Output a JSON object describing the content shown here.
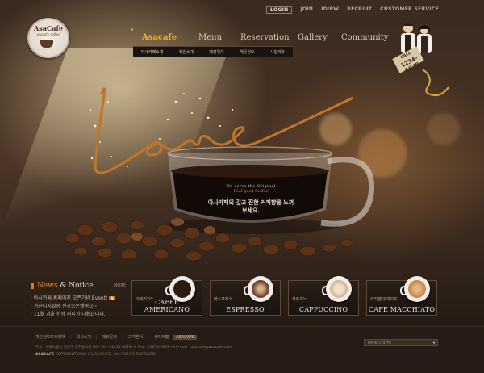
{
  "top_links": [
    "LOGIN",
    "JOIN",
    "ID/PW",
    "RECRUIT",
    "CUSTOMER SERVICE"
  ],
  "brand": {
    "logo_text": "AsaCafe",
    "logo_sub": "asacafe coffee"
  },
  "nav": [
    "Asacafe",
    "Menu",
    "Reservation",
    "Gallery",
    "Community"
  ],
  "subnav": [
    "아사카페소개",
    "직원소개",
    "매장위치",
    "채용정보",
    "사업제휴"
  ],
  "hero": {
    "script_word": "Love",
    "tagline_1": "We serve the Original",
    "tagline_2": "Feel-good Coffee",
    "tagline_kr": "아사카페의 깊고 진한 커피향을 느껴보세요.",
    "tag_label": "CALL",
    "tag_number": "1234-5678"
  },
  "news": {
    "title_prefix": "News",
    "title_rest": " & Notice",
    "more": "MORE",
    "items": [
      {
        "text": "아사카페 홈페이지 오픈기념 Event!",
        "badge": "N"
      },
      {
        "text": "가산디지털점 신규오픈했어요~",
        "badge": ""
      },
      {
        "text": "11월 겨울 한정 커피가 나왔습니다.",
        "badge": ""
      }
    ]
  },
  "menu_cards": [
    {
      "kr": "아메리카노",
      "en": "CAFFE AMERICANO",
      "coffee": "#2a1a10"
    },
    {
      "kr": "에스프레소",
      "en": "ESPRESSO",
      "coffee": "#5a3420"
    },
    {
      "kr": "카푸치노",
      "en": "CAPPUCCINO",
      "coffee": "#c8a47b"
    },
    {
      "kr": "카라멜 마끼아또",
      "en": "CAFE MACCHIATO",
      "coffee": "#c07c3c"
    }
  ],
  "footer": {
    "links": [
      "개인정보보호정책",
      "회사소개",
      "제휴문의",
      "고객센터",
      "사이트맵"
    ],
    "badge": "ASACAFE",
    "address": "주소 : 서울특별시 가산구 디지털 1길 000   Tel : 01234-5678~9   Fax : 01234-5678~9   E-mail : asacafe@asacafe.com",
    "copyright_brand": "ASACAFE",
    "copyright": "COPYRIGHT 2012 (C) ASACAFE. ALL RIGHTS RESERVED.",
    "family_site": "FAMILY SITE"
  }
}
